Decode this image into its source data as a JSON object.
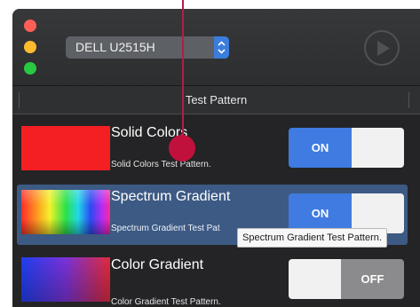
{
  "toolbar": {
    "display_select": {
      "value": "DELL U2515H",
      "icon": "up-down-chevron-icon"
    },
    "play_icon": "play-icon"
  },
  "list": {
    "column_header": "Test Pattern",
    "items": [
      {
        "title": "Solid Colors",
        "subtitle": "Solid Colors Test Pattern.",
        "toggle": "ON",
        "state": "on",
        "swatch": "solid red"
      },
      {
        "title": "Spectrum Gradient",
        "subtitle": "Spectrum Gradient Test Pat",
        "toggle": "ON",
        "state": "on",
        "selected": true,
        "swatch": "spectrum"
      },
      {
        "title": "Color Gradient",
        "subtitle": "Color Gradient Test Pattern.",
        "toggle": "OFF",
        "state": "off",
        "swatch": "color gradient"
      }
    ]
  },
  "tooltip": {
    "text": "Spectrum Gradient Test Pattern."
  },
  "colors": {
    "accent": "#3f7be0",
    "selection": "#3d5a84",
    "swatch_red": "#f41f22",
    "cursor": "#c0113c"
  }
}
